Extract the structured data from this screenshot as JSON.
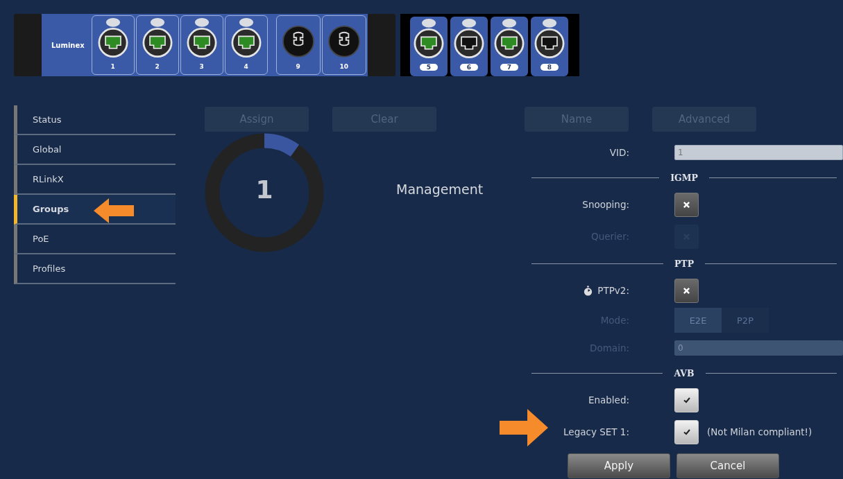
{
  "device": {
    "units": [
      {
        "kind": "main",
        "brand": "Luminex",
        "ports": [
          {
            "label": "1",
            "kind": "rj45",
            "link": true
          },
          {
            "label": "2",
            "kind": "rj45",
            "link": true
          },
          {
            "label": "3",
            "kind": "rj45",
            "link": true
          },
          {
            "label": "4",
            "kind": "rj45",
            "link": true
          },
          {
            "label": "9",
            "kind": "circular"
          },
          {
            "label": "10",
            "kind": "circular"
          }
        ]
      },
      {
        "kind": "expansion",
        "ports": [
          {
            "label": "5",
            "kind": "rj45",
            "link": true
          },
          {
            "label": "6",
            "kind": "rj45",
            "link": false
          },
          {
            "label": "7",
            "kind": "rj45",
            "link": true
          },
          {
            "label": "8",
            "kind": "rj45",
            "link": false
          }
        ]
      }
    ]
  },
  "sidebar": {
    "items": [
      {
        "label": "Status",
        "selected": false,
        "pointer": false
      },
      {
        "label": "Global",
        "selected": false,
        "pointer": false
      },
      {
        "label": "RLinkX",
        "selected": false,
        "pointer": false
      },
      {
        "label": "Groups",
        "selected": true,
        "pointer": true
      },
      {
        "label": "PoE",
        "selected": false,
        "pointer": false
      },
      {
        "label": "Profiles",
        "selected": false,
        "pointer": false
      }
    ]
  },
  "group": {
    "buttons": [
      {
        "label": "Assign",
        "disabled": true
      },
      {
        "label": "Clear",
        "disabled": true
      }
    ],
    "number": "1",
    "name": "Management"
  },
  "settings": {
    "buttons": [
      {
        "label": "Name",
        "disabled": true
      },
      {
        "label": "Advanced",
        "disabled": true
      }
    ],
    "rows": [
      {
        "kind": "text",
        "label": "VID:",
        "value": "1",
        "disabled": false
      },
      {
        "kind": "section",
        "label": "IGMP"
      },
      {
        "kind": "toggle",
        "label": "Snooping:",
        "on": false,
        "disabled": false
      },
      {
        "kind": "toggle",
        "label": "Querier:",
        "on": false,
        "disabled": true
      },
      {
        "kind": "section",
        "label": "PTP"
      },
      {
        "kind": "toggle",
        "label": "PTPv2:",
        "on": false,
        "disabled": false,
        "icon": true
      },
      {
        "kind": "segmented",
        "label": "Mode:",
        "disabled": true,
        "options": [
          {
            "label": "E2E",
            "selected": true
          },
          {
            "label": "P2P",
            "selected": false
          }
        ]
      },
      {
        "kind": "text",
        "label": "Domain:",
        "value": "0",
        "disabled": true
      },
      {
        "kind": "section",
        "label": "AVB"
      },
      {
        "kind": "toggle",
        "label": "Enabled:",
        "on": true,
        "disabled": false
      },
      {
        "kind": "toggle",
        "label": "Legacy SET 1:",
        "on": true,
        "disabled": false,
        "pointer": true,
        "note": "(Not Milan compliant!)"
      }
    ],
    "footer": [
      {
        "label": "Apply"
      },
      {
        "label": "Cancel"
      }
    ]
  }
}
